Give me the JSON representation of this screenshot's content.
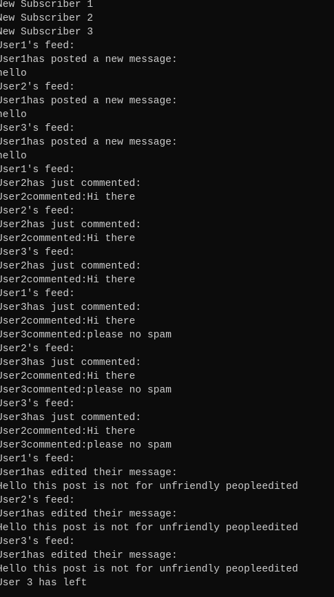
{
  "console": {
    "lines": [
      "New Subscriber 1",
      "New Subscriber 2",
      "New Subscriber 3",
      "User1's feed:",
      "User1has posted a new message:",
      "hello",
      "User2's feed:",
      "User1has posted a new message:",
      "hello",
      "User3's feed:",
      "User1has posted a new message:",
      "hello",
      "User1's feed:",
      "User2has just commented:",
      "User2commented:Hi there",
      "User2's feed:",
      "User2has just commented:",
      "User2commented:Hi there",
      "User3's feed:",
      "User2has just commented:",
      "User2commented:Hi there",
      "User1's feed:",
      "User3has just commented:",
      "User2commented:Hi there",
      "User3commented:please no spam",
      "User2's feed:",
      "User3has just commented:",
      "User2commented:Hi there",
      "User3commented:please no spam",
      "User3's feed:",
      "User3has just commented:",
      "User2commented:Hi there",
      "User3commented:please no spam",
      "User1's feed:",
      "User1has edited their message:",
      "Hello this post is not for unfriendly peopleedited",
      "User2's feed:",
      "User1has edited their message:",
      "Hello this post is not for unfriendly peopleedited",
      "User3's feed:",
      "User1has edited their message:",
      "Hello this post is not for unfriendly peopleedited",
      "User 3 has left"
    ]
  }
}
